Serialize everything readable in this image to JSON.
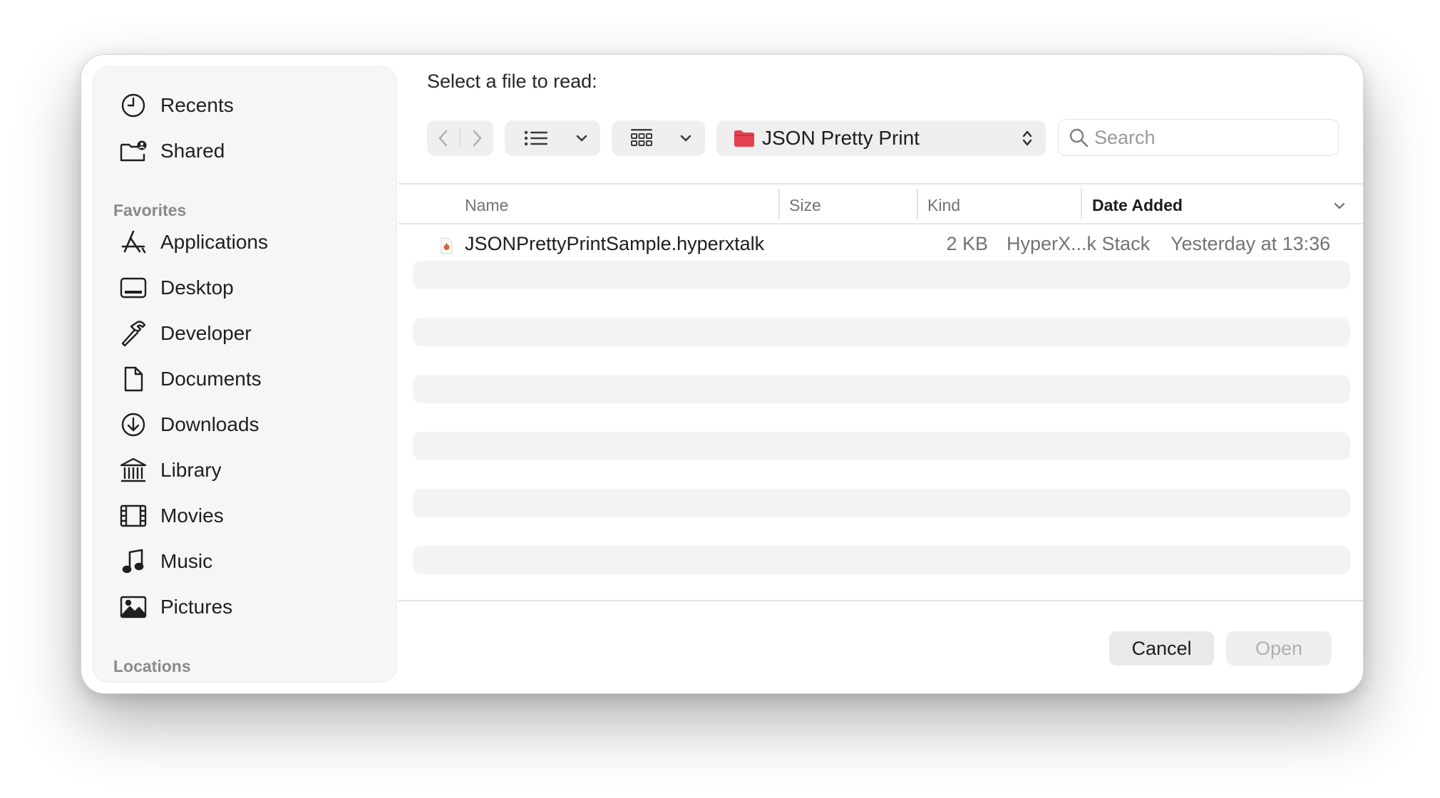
{
  "dialog": {
    "prompt": "Select a file to read:"
  },
  "sidebar": {
    "top_items": [
      {
        "label": "Recents",
        "icon": "clock-icon"
      },
      {
        "label": "Shared",
        "icon": "shared-folder-icon"
      }
    ],
    "favorites_heading": "Favorites",
    "favorites": [
      {
        "label": "Applications",
        "icon": "applications-icon"
      },
      {
        "label": "Desktop",
        "icon": "desktop-icon"
      },
      {
        "label": "Developer",
        "icon": "hammer-icon"
      },
      {
        "label": "Documents",
        "icon": "document-icon"
      },
      {
        "label": "Downloads",
        "icon": "download-icon"
      },
      {
        "label": "Library",
        "icon": "library-icon"
      },
      {
        "label": "Movies",
        "icon": "film-icon"
      },
      {
        "label": "Music",
        "icon": "music-note-icon"
      },
      {
        "label": "Pictures",
        "icon": "photo-icon"
      }
    ],
    "locations_heading": "Locations"
  },
  "toolbar": {
    "location": "JSON Pretty Print",
    "location_folder_color": "#e5404f",
    "search_placeholder": "Search"
  },
  "columns": {
    "name": "Name",
    "size": "Size",
    "kind": "Kind",
    "date_added": "Date Added",
    "sorted_by": "date_added"
  },
  "files": [
    {
      "name": "JSONPrettyPrintSample.hyperxtalk",
      "size": "2 KB",
      "kind": "HyperX...k Stack",
      "date_added": "Yesterday at 13:36"
    }
  ],
  "buttons": {
    "cancel": "Cancel",
    "open": "Open",
    "open_enabled": false
  },
  "colors": {
    "text_primary": "#1d1d1f",
    "text_secondary": "#737373",
    "disabled_text": "#b0b0b0",
    "sidebar_bg": "#f6f6f6"
  }
}
